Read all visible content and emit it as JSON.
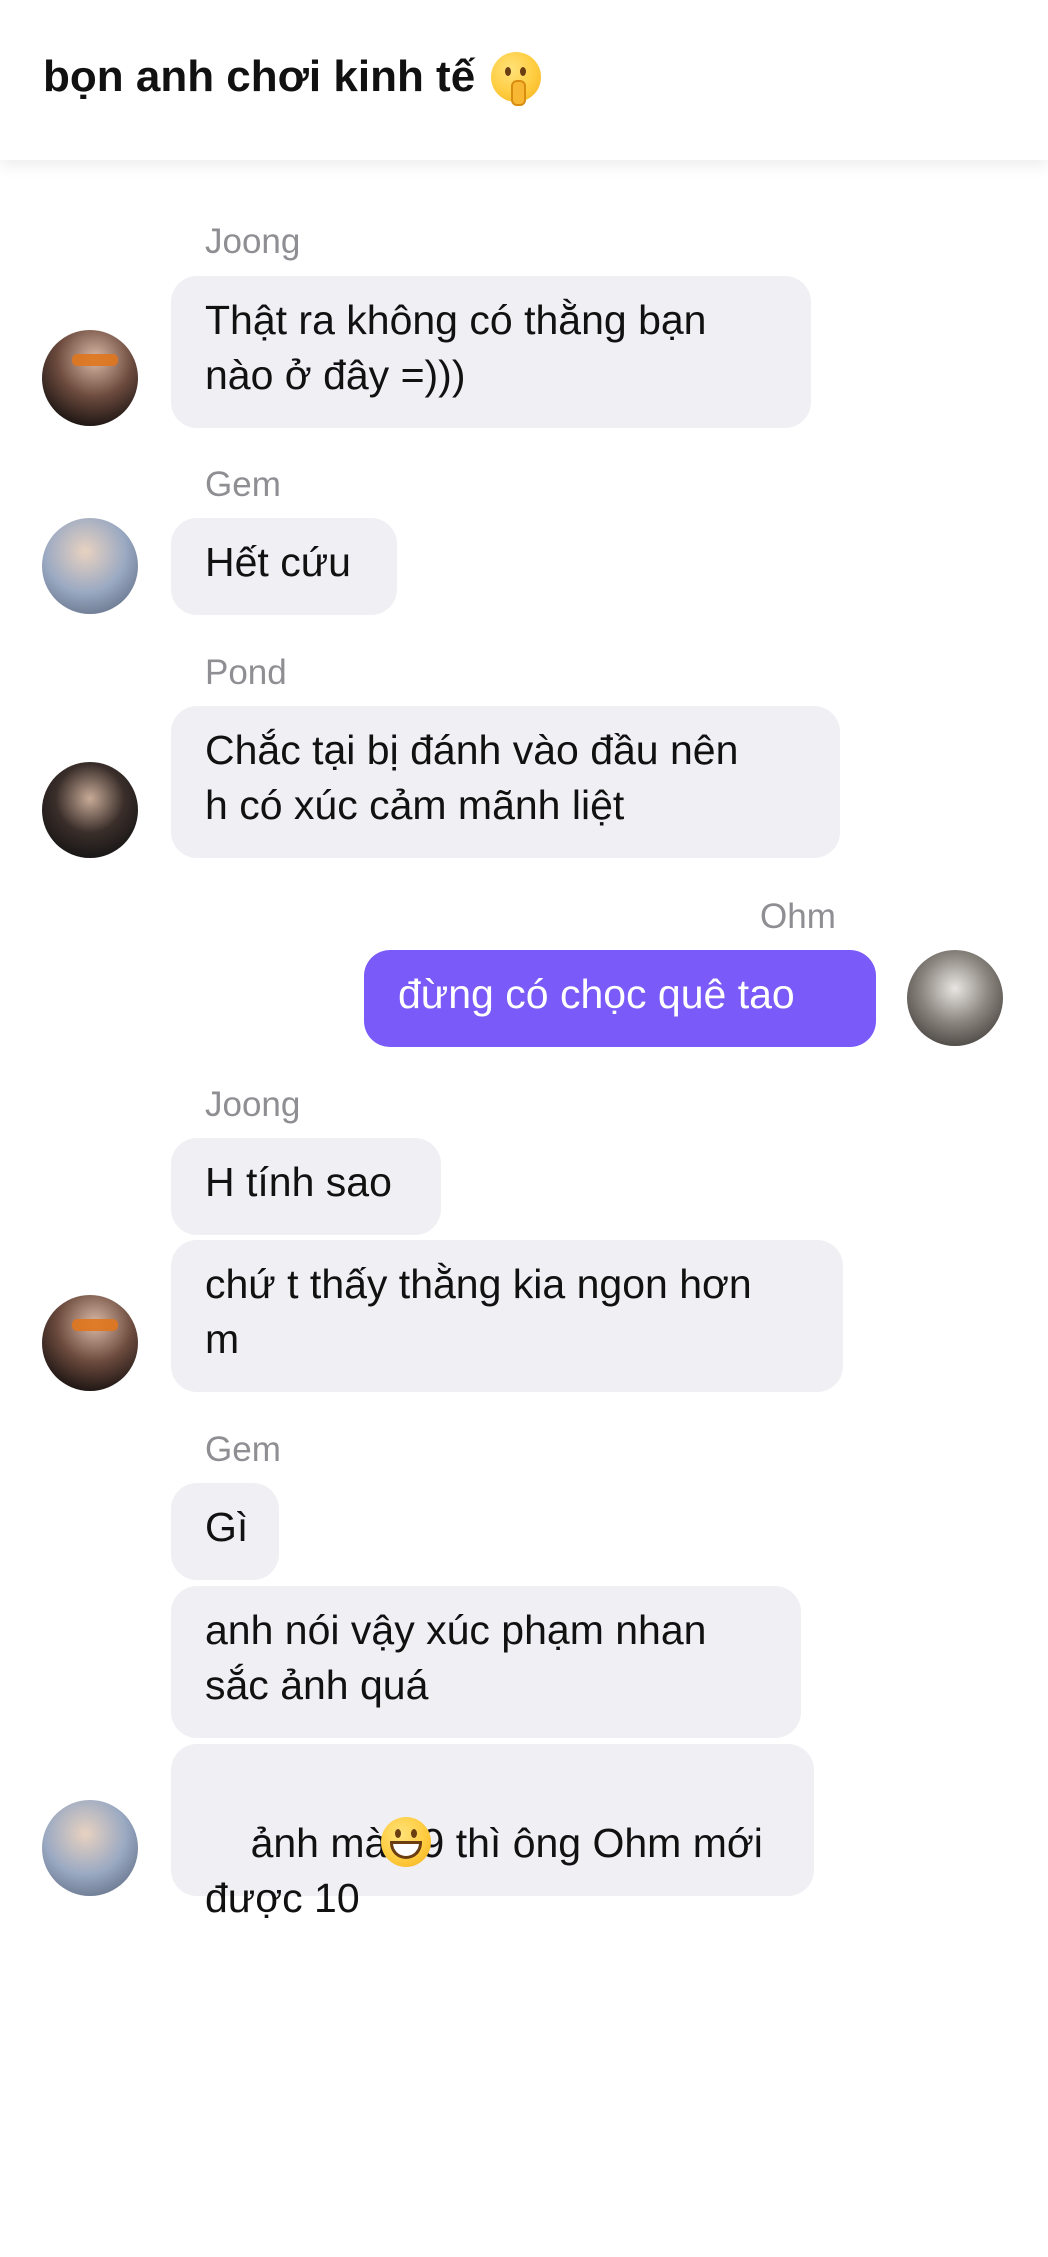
{
  "header": {
    "title": "bọn anh chơi kinh tế",
    "title_emoji": "shushing-face-emoji"
  },
  "messages": [
    {
      "sender": "Joong",
      "bubbles": [
        "Thật ra không có thằng bạn\nnào ở đây =)))"
      ]
    },
    {
      "sender": "Gem",
      "bubbles": [
        "Hết cứu"
      ]
    },
    {
      "sender": "Pond",
      "bubbles": [
        "Chắc tại bị đánh vào đầu nên\nh có xúc cảm mãnh liệt"
      ]
    },
    {
      "sender": "Ohm",
      "outgoing": true,
      "bubbles": [
        "đừng có chọc quê tao"
      ]
    },
    {
      "sender": "Joong",
      "bubbles": [
        "H tính sao",
        "chứ t thấy thằng kia ngon hơn\nm"
      ]
    },
    {
      "sender": "Gem",
      "bubbles": [
        "Gì",
        "anh nói vậy xúc phạm nhan\nsắc ảnh quá",
        "ảnh mà 49 thì ông Ohm mới\nđược 10"
      ],
      "last_bubble_emoji": "grinning-face-emoji"
    }
  ],
  "colors": {
    "incoming_bubble": "#efeff4",
    "outgoing_bubble": "#7a5af8",
    "sender_name": "#8e8e93"
  }
}
